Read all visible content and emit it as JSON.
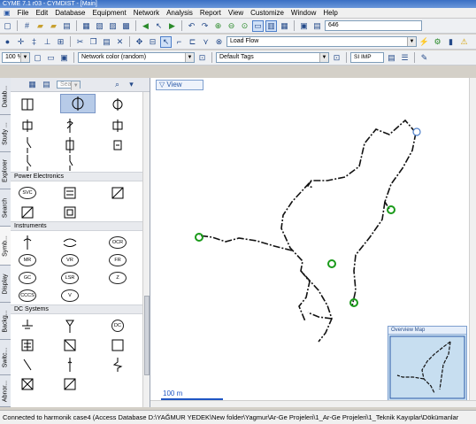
{
  "window": {
    "title": "CYME 7.1 r03 - CYMDIST - [Main]"
  },
  "menu": [
    "File",
    "Edit",
    "Database",
    "Equipment",
    "Network",
    "Analysis",
    "Report",
    "View",
    "Customize",
    "Window",
    "Help"
  ],
  "toolbar1": {
    "right_value": "646"
  },
  "toolbar2": {
    "study_combo": "Load Flow"
  },
  "toolbar3": {
    "zoom_combo": "100 %",
    "color_combo": "Network color (random)",
    "tags_combo": "Default Tags",
    "si_label": "SI",
    "imp_label": "IMP"
  },
  "palette": {
    "search_placeholder": "Search",
    "sections": [
      "Power Electronics",
      "Instruments",
      "DC Systems"
    ],
    "symbol_labels": [
      "SVC",
      "OCR",
      "MR",
      "VR",
      "FR",
      "GC",
      "LSR",
      "Z",
      "CCCS",
      "V",
      "DC"
    ]
  },
  "left_tabs": [
    "Datab...",
    "Study ...",
    "Explorer",
    "Search",
    "Symb...",
    "Display",
    "Backg...",
    "Switc...",
    "Abnor..."
  ],
  "canvas": {
    "view_button": "View",
    "scale_label": "100 m",
    "overview_title": "Overview Map"
  },
  "status": {
    "text": "Connected to harmonik case4 (Access Database D:\\YAĞMUR YEDEK\\New folder\\Yagmur\\Ar-Ge Projeleri\\1_Ar-Ge Projeleri\\1_Teknik Kayıplar\\Dökümanlar"
  },
  "colors": {
    "accent": "#2b5aa8",
    "node_green": "#1a9a1a",
    "line": "#111111",
    "overview_bg": "#c7def0"
  }
}
